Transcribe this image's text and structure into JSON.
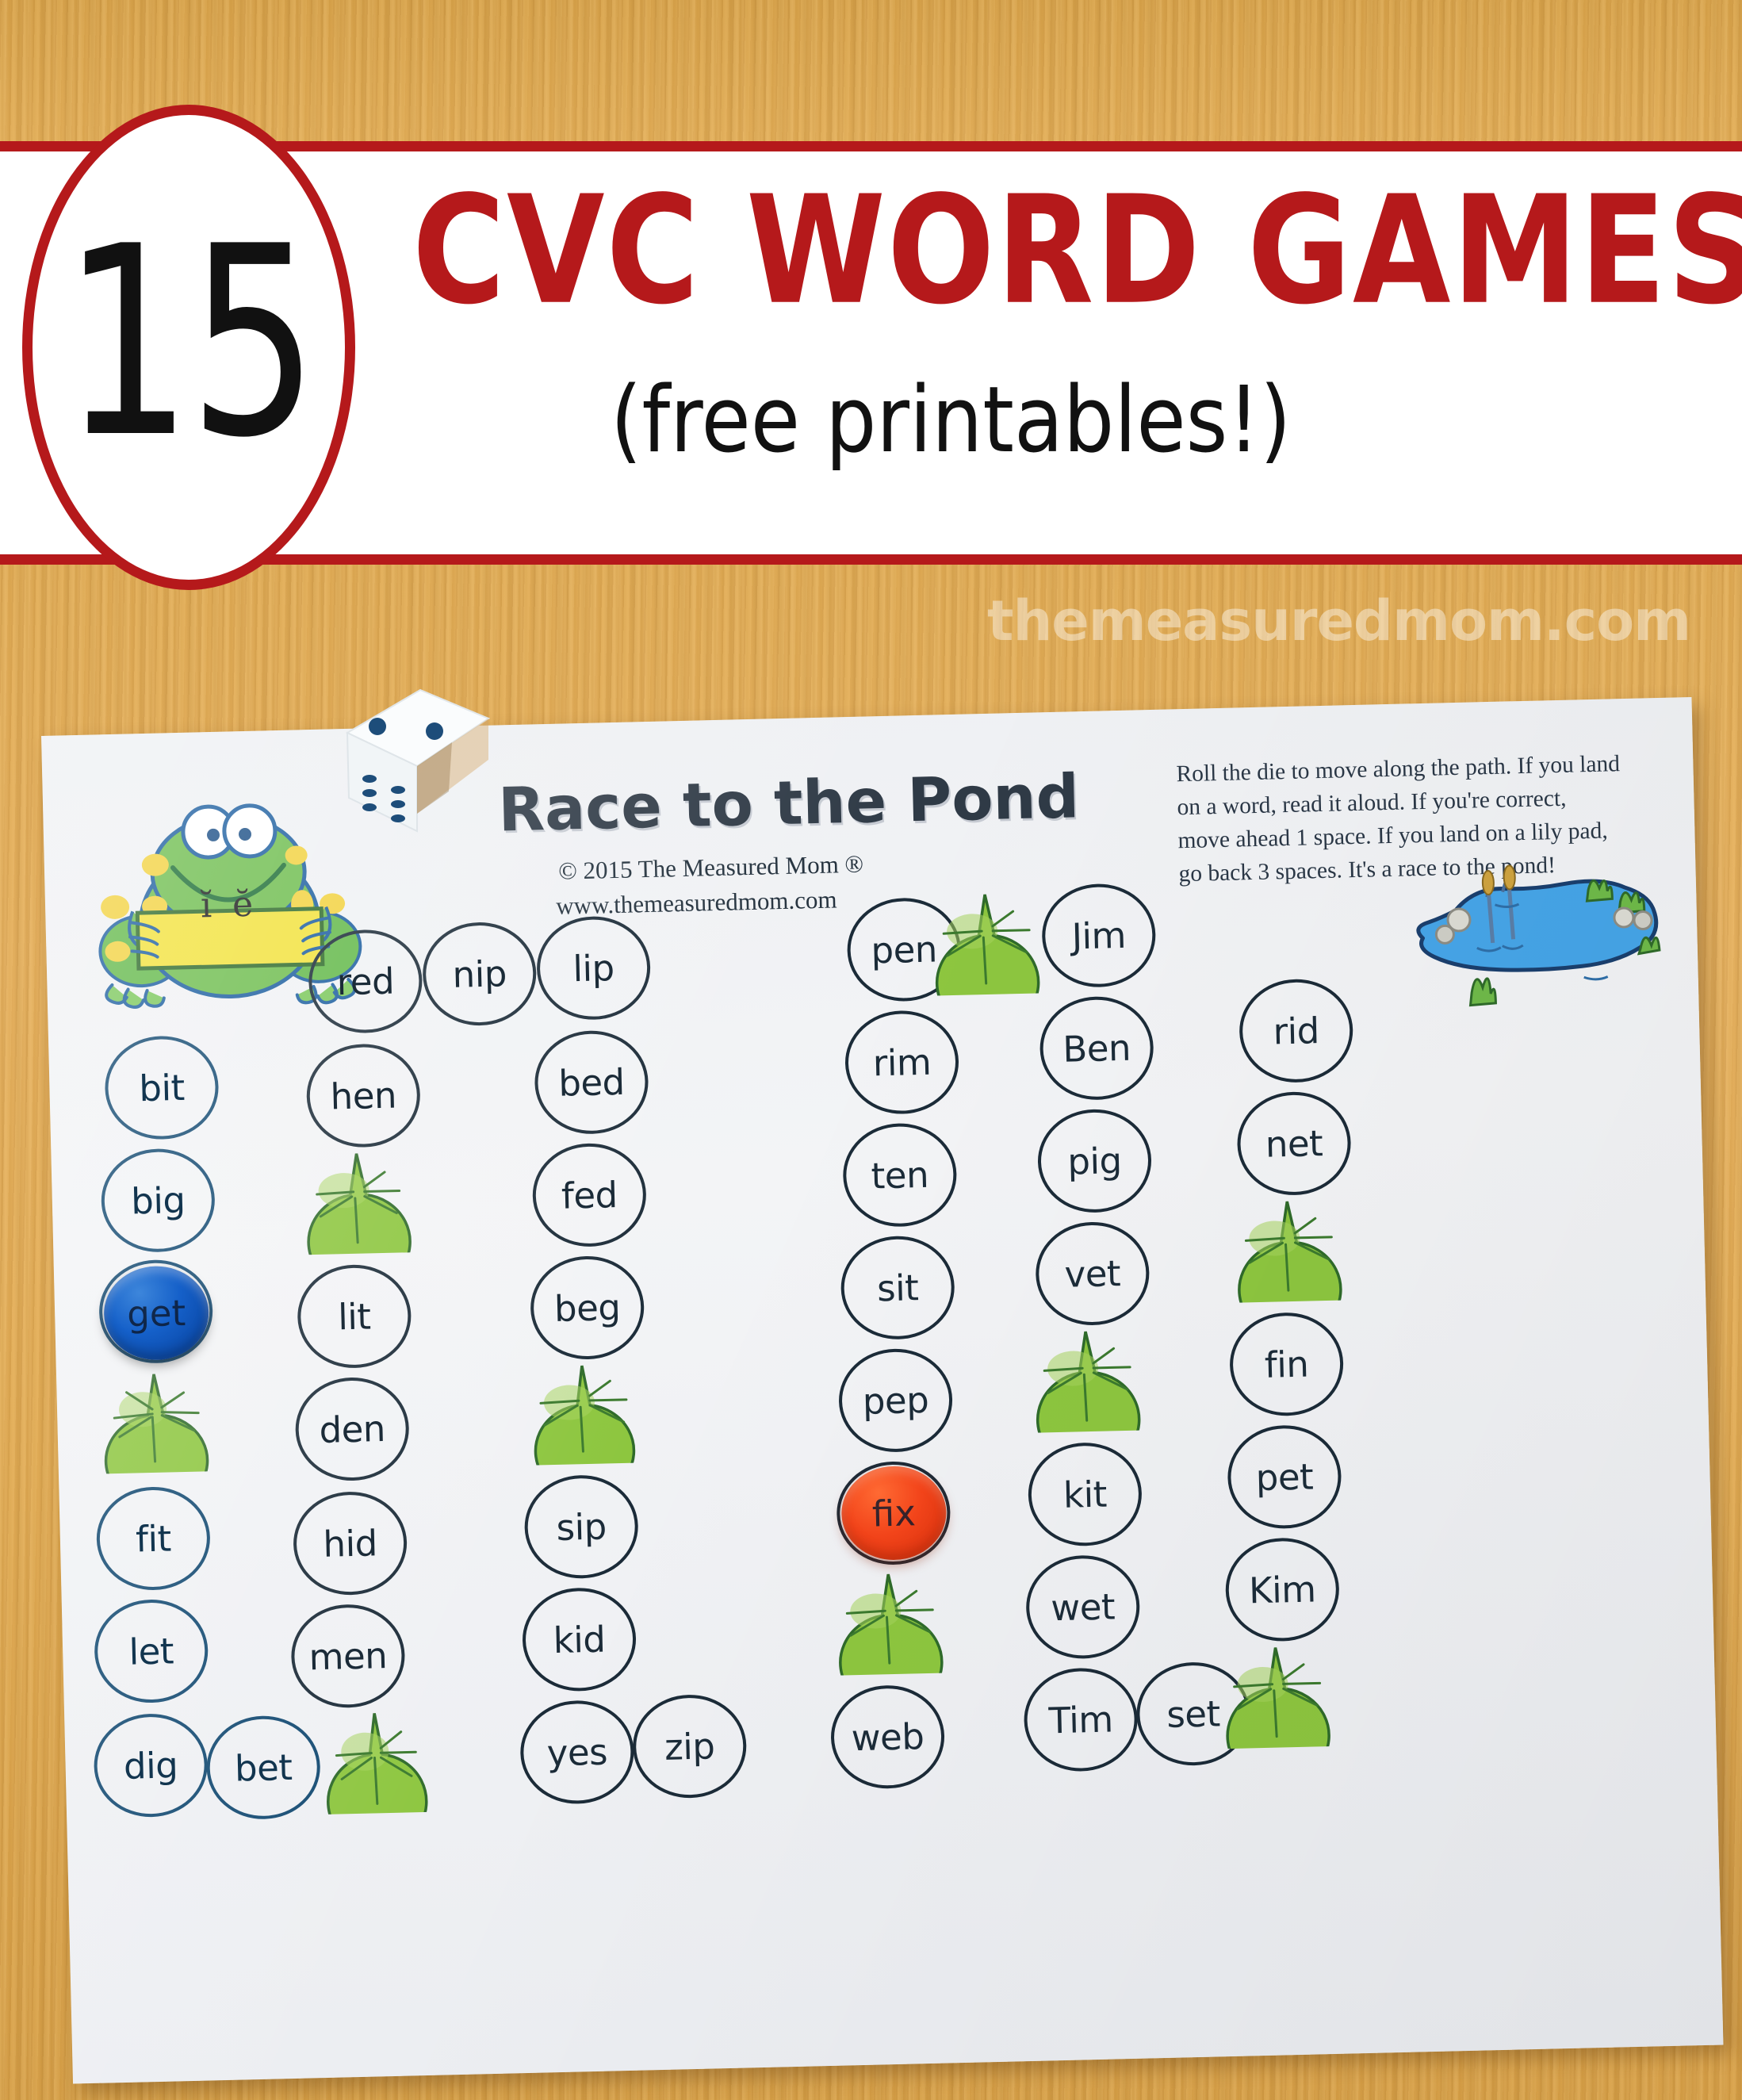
{
  "header": {
    "number": "15",
    "title": "CVC WORD GAMES",
    "subtitle": "(free printables!)",
    "watermark": "themeasuredmom.com",
    "accent_color": "#b5191b"
  },
  "worksheet": {
    "title": "Race to the Pond",
    "copyright": "© 2015 The Measured Mom ®",
    "url": "www.themeasuredmom.com",
    "instructions": "Roll the die to move along the path.  If you land on a word, read it aloud. If you're correct, move ahead 1 space.  If you land on a lily pad, go back 3 spaces.  It's a race to the pond!",
    "frog_sign": "ĭ ĕ",
    "pond_label": "pond-illustration"
  },
  "board": {
    "columns": [
      {
        "name": "column-1",
        "spaces": [
          {
            "type": "word",
            "label": "bit"
          },
          {
            "type": "word",
            "label": "big"
          },
          {
            "type": "word",
            "label": "get",
            "token": "blue"
          },
          {
            "type": "lilypad",
            "label": ""
          },
          {
            "type": "word",
            "label": "fit"
          },
          {
            "type": "word",
            "label": "let"
          },
          {
            "type": "word",
            "label": "dig"
          }
        ]
      },
      {
        "name": "column-1b",
        "spaces": [
          {
            "type": "word",
            "label": "bet"
          }
        ]
      },
      {
        "name": "column-2",
        "spaces": [
          {
            "type": "word",
            "label": "red"
          },
          {
            "type": "word",
            "label": "hen"
          },
          {
            "type": "lilypad",
            "label": ""
          },
          {
            "type": "word",
            "label": "lit"
          },
          {
            "type": "word",
            "label": "den"
          },
          {
            "type": "word",
            "label": "hid"
          },
          {
            "type": "word",
            "label": "men"
          },
          {
            "type": "lilypad",
            "label": ""
          }
        ]
      },
      {
        "name": "column-3",
        "spaces": [
          {
            "type": "word",
            "label": "nip"
          }
        ]
      },
      {
        "name": "column-4",
        "spaces": [
          {
            "type": "word",
            "label": "lip"
          },
          {
            "type": "word",
            "label": "bed"
          },
          {
            "type": "word",
            "label": "fed"
          },
          {
            "type": "word",
            "label": "beg"
          },
          {
            "type": "lilypad",
            "label": ""
          },
          {
            "type": "word",
            "label": "sip"
          },
          {
            "type": "word",
            "label": "kid"
          },
          {
            "type": "word",
            "label": "yes"
          }
        ]
      },
      {
        "name": "column-5",
        "spaces": [
          {
            "type": "word",
            "label": "zip"
          }
        ]
      },
      {
        "name": "column-6",
        "spaces": [
          {
            "type": "word",
            "label": "pen"
          },
          {
            "type": "word",
            "label": "rim"
          },
          {
            "type": "word",
            "label": "ten"
          },
          {
            "type": "word",
            "label": "sit"
          },
          {
            "type": "word",
            "label": "pep"
          },
          {
            "type": "word",
            "label": "fix",
            "token": "orange"
          },
          {
            "type": "lilypad",
            "label": ""
          },
          {
            "type": "word",
            "label": "web"
          }
        ]
      },
      {
        "name": "column-7",
        "spaces": [
          {
            "type": "lilypad",
            "label": ""
          }
        ]
      },
      {
        "name": "column-8",
        "spaces": [
          {
            "type": "word",
            "label": "Jim"
          },
          {
            "type": "word",
            "label": "Ben"
          },
          {
            "type": "word",
            "label": "pig"
          },
          {
            "type": "word",
            "label": "vet"
          },
          {
            "type": "lilypad",
            "label": ""
          },
          {
            "type": "word",
            "label": "kit"
          },
          {
            "type": "word",
            "label": "wet"
          },
          {
            "type": "word",
            "label": "Tim"
          }
        ]
      },
      {
        "name": "column-9",
        "spaces": [
          {
            "type": "word",
            "label": "set"
          }
        ]
      },
      {
        "name": "column-10",
        "spaces": [
          {
            "type": "word",
            "label": "rid"
          },
          {
            "type": "word",
            "label": "net"
          },
          {
            "type": "lilypad",
            "label": ""
          },
          {
            "type": "word",
            "label": "fin"
          },
          {
            "type": "word",
            "label": "pet"
          },
          {
            "type": "word",
            "label": "Kim"
          },
          {
            "type": "lilypad",
            "label": ""
          }
        ]
      }
    ],
    "words_in_order": [
      "bit",
      "big",
      "get",
      "fit",
      "let",
      "dig",
      "bet",
      "red",
      "hen",
      "lit",
      "den",
      "hid",
      "men",
      "nip",
      "lip",
      "bed",
      "fed",
      "beg",
      "sip",
      "kid",
      "yes",
      "zip",
      "pen",
      "rim",
      "ten",
      "sit",
      "pep",
      "fix",
      "web",
      "Jim",
      "Ben",
      "pig",
      "vet",
      "kit",
      "wet",
      "Tim",
      "set",
      "rid",
      "net",
      "fin",
      "pet",
      "Kim"
    ]
  },
  "tokens": [
    {
      "name": "blue-game-piece",
      "color": "#1560c9",
      "on_word": "get"
    },
    {
      "name": "orange-game-piece",
      "color": "#f2441a",
      "on_word": "fix"
    }
  ],
  "die": {
    "name": "white-die",
    "top_face_pips": 2,
    "front_face_pips": 6,
    "pip_color": "#1d4d7a",
    "body_color": "#f6f8f9"
  },
  "labels": {
    "word_bit": "bit",
    "word_big": "big",
    "word_get": "get",
    "word_fit": "fit",
    "word_let": "let",
    "word_dig": "dig",
    "word_bet": "bet",
    "word_red": "red",
    "word_hen": "hen",
    "word_lit": "lit",
    "word_den": "den",
    "word_hid": "hid",
    "word_men": "men",
    "word_nip": "nip",
    "word_lip": "lip",
    "word_bed": "bed",
    "word_fed": "fed",
    "word_beg": "beg",
    "word_sip": "sip",
    "word_kid": "kid",
    "word_yes": "yes",
    "word_zip": "zip",
    "word_pen": "pen",
    "word_rim": "rim",
    "word_ten": "ten",
    "word_sit": "sit",
    "word_pep": "pep",
    "word_fix": "fix",
    "word_web": "web",
    "word_Jim": "Jim",
    "word_Ben": "Ben",
    "word_pig": "pig",
    "word_vet": "vet",
    "word_kit": "kit",
    "word_wet": "wet",
    "word_Tim": "Tim",
    "word_set": "set",
    "word_rid": "rid",
    "word_net": "net",
    "word_fin": "fin",
    "word_pet": "pet",
    "word_Kim": "Kim"
  }
}
